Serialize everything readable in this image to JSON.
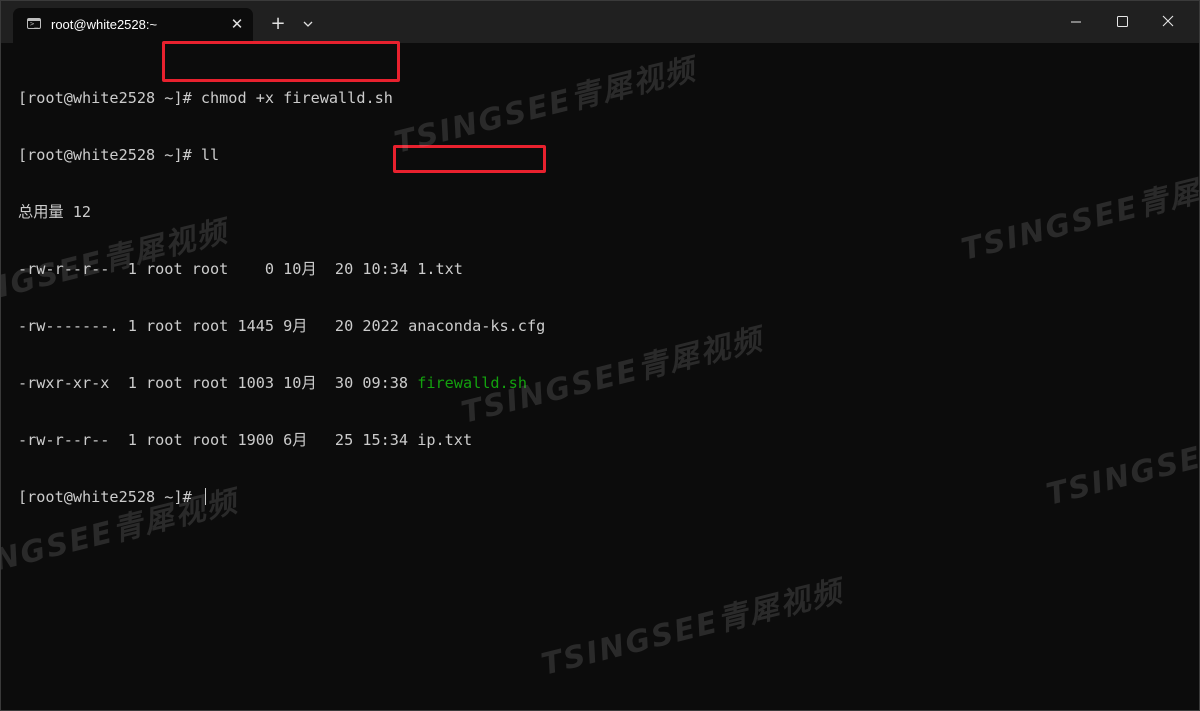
{
  "window": {
    "tab_title": "root@white2528:~",
    "new_tab_glyph": "+",
    "close_tab_glyph": "✕"
  },
  "terminal": {
    "lines": [
      {
        "prefix": "[root@white2528 ~]# ",
        "text": "chmod +x firewalld.sh"
      },
      {
        "prefix": "[root@white2528 ~]# ",
        "text": "ll"
      },
      {
        "text": "总用量 12"
      },
      {
        "text": "-rw-r--r--  1 root root    0 10月  20 10:34 1.txt"
      },
      {
        "text": "-rw-------. 1 root root 1445 9月   20 2022 anaconda-ks.cfg"
      },
      {
        "text": "-rwxr-xr-x  1 root root 1003 10月  30 09:38 ",
        "highlight_file": "firewalld.sh"
      },
      {
        "text": "-rw-r--r--  1 root root 1900 6月   25 15:34 ip.txt"
      },
      {
        "prefix": "[root@white2528 ~]# ",
        "text": ""
      }
    ]
  },
  "watermark": {
    "text": "TSINGSEE青犀视频"
  },
  "colors": {
    "background": "#0c0c0c",
    "titlebar": "#202020",
    "foreground": "#cccccc",
    "executable": "#13a10e",
    "highlight_box": "#e8212e"
  },
  "icons": {
    "tab": "terminal-icon",
    "close": "close-icon",
    "new_tab": "plus-icon",
    "dropdown": "chevron-down-icon",
    "minimize": "minimize-icon",
    "maximize": "maximize-icon",
    "window_close": "window-close-icon"
  }
}
